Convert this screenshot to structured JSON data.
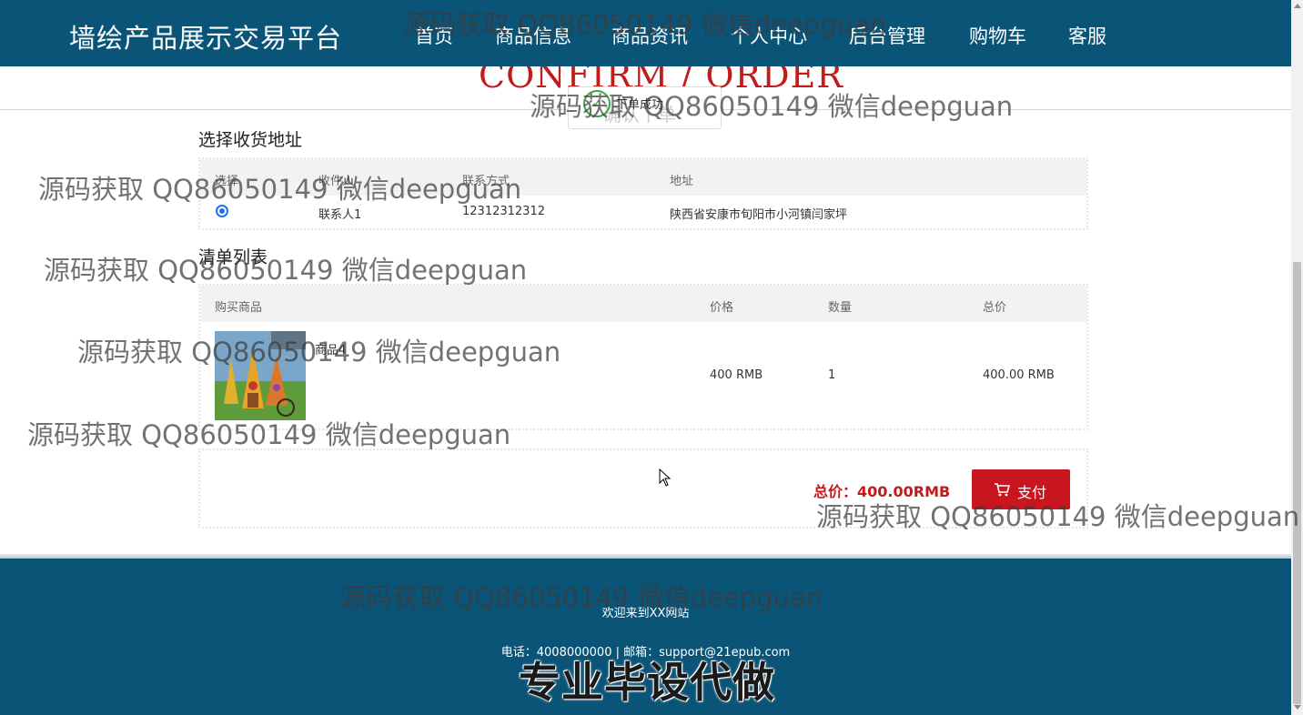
{
  "brand": "墙绘产品展示交易平台",
  "nav": [
    "首页",
    "商品信息",
    "商品资讯",
    "个人中心",
    "后台管理",
    "购物车",
    "客服"
  ],
  "header": {
    "title": "CONFIRM / ORDER",
    "step_text": "下单成功",
    "step_ghost": "确认下单"
  },
  "address": {
    "title": "选择收货地址",
    "headers": [
      "选择",
      "收件人",
      "联系方式",
      "地址"
    ],
    "rows": [
      {
        "selected": true,
        "name": "联系人1",
        "phone": "12312312312",
        "address": "陕西省安康市旬阳市小河镇闫家坪"
      }
    ]
  },
  "order": {
    "title": "清单列表",
    "headers": [
      "购买商品",
      "价格",
      "数量",
      "总价"
    ],
    "items": [
      {
        "name": "商品4",
        "price": "400 RMB",
        "qty": "1",
        "total": "400.00 RMB"
      }
    ]
  },
  "summary": {
    "total": "总价：400.00RMB",
    "pay_label": "支付"
  },
  "footer": {
    "welcome": "欢迎来到XX网站",
    "contact": "电话：4008000000 | 邮箱：support@21epub.com"
  },
  "watermark": {
    "text": "源码获取 QQ86050149 微信deepguan",
    "big": "专业毕设代做"
  },
  "colors": {
    "nav_bg": "#0a5478",
    "accent_red": "#c9151e",
    "radio_blue": "#1a73e8"
  }
}
